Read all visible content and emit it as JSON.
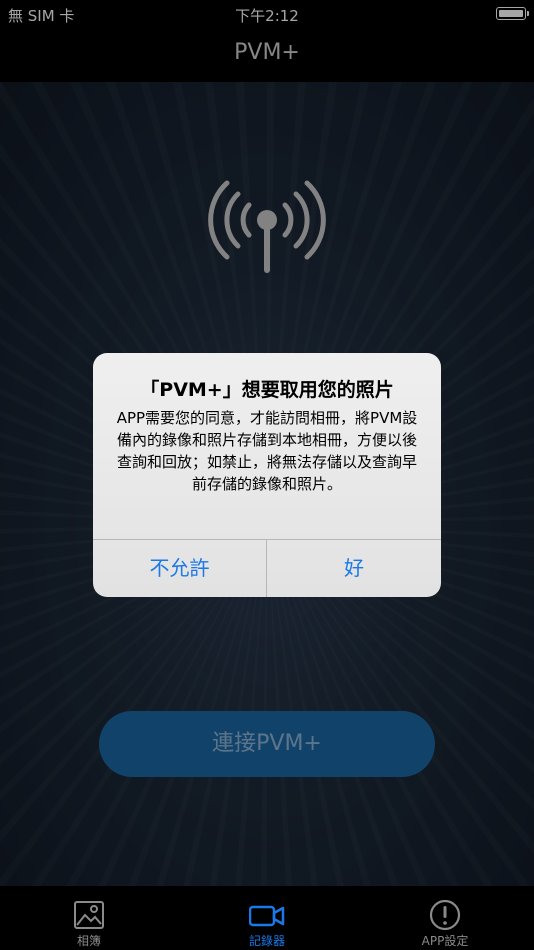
{
  "status_bar": {
    "carrier": "無 SIM 卡",
    "time": "下午2:12",
    "battery_level": 1.0
  },
  "nav": {
    "title": "PVM+"
  },
  "main": {
    "signal_icon": "antenna-signal-icon",
    "connect_label": "連接PVM+"
  },
  "alert": {
    "title": "「PVM+」想要取用您的照片",
    "message": "APP需要您的同意，才能訪問相冊，將PVM設備內的錄像和照片存儲到本地相冊，方便以後查詢和回放；如禁止，將無法存儲以及查詢早前存儲的錄像和照片。",
    "deny_label": "不允許",
    "ok_label": "好"
  },
  "tabs": [
    {
      "label": "相簿",
      "icon": "photo-album-icon",
      "selected": false
    },
    {
      "label": "記錄器",
      "icon": "video-camera-icon",
      "selected": true
    },
    {
      "label": "APP設定",
      "icon": "exclamation-circle-icon",
      "selected": false
    }
  ],
  "colors": {
    "accent": "#1a78e8",
    "button": "#1b67a3",
    "background": "#1c2838"
  }
}
